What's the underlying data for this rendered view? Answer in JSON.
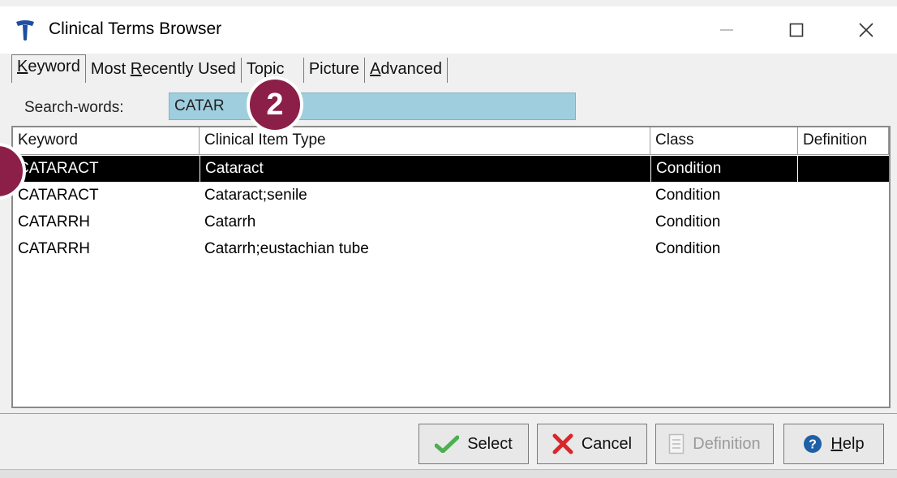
{
  "window": {
    "title": "Clinical Terms Browser",
    "icon": "telstra-health-icon"
  },
  "title_buttons": {
    "minimize": "minimize-icon",
    "maximize": "maximize-icon",
    "close": "close-icon"
  },
  "tabs": [
    {
      "pre": "",
      "accel": "K",
      "post": "eyword",
      "active": true
    },
    {
      "pre": "Most ",
      "accel": "R",
      "post": "ecently Used",
      "active": false
    },
    {
      "pre": "",
      "accel": "",
      "post": "Topic",
      "active": false
    },
    {
      "pre": "Picture",
      "accel": "",
      "post": "",
      "active": false
    },
    {
      "pre": "",
      "accel": "A",
      "post": "dvanced",
      "active": false
    }
  ],
  "search": {
    "label": "Search-words:",
    "value": "CATAR"
  },
  "columns": [
    "Keyword",
    "Clinical Item Type",
    "Class",
    "Definition"
  ],
  "rows": [
    {
      "keyword": "CATARACT",
      "type": "Cataract",
      "class": "Condition",
      "definition": ""
    },
    {
      "keyword": "CATARACT",
      "type": "Cataract;senile",
      "class": "Condition",
      "definition": ""
    },
    {
      "keyword": "CATARRH",
      "type": "Catarrh",
      "class": "Condition",
      "definition": ""
    },
    {
      "keyword": "CATARRH",
      "type": "Catarrh;eustachian tube",
      "class": "Condition",
      "definition": ""
    }
  ],
  "selected_row": 0,
  "buttons": {
    "select": {
      "label": "Select",
      "icon": "checkmark-icon"
    },
    "cancel": {
      "label": "Cancel",
      "icon": "x-cancel-icon"
    },
    "definition": {
      "label": "Definition",
      "icon": "document-icon",
      "enabled": false
    },
    "help": {
      "pre": "",
      "accel": "H",
      "post": "elp",
      "icon": "help-icon"
    }
  },
  "callouts": {
    "badge_2": "2"
  },
  "colors": {
    "search_bg": "#9fcfde",
    "selected_row_bg": "#000000",
    "callout": "#8b1f47",
    "check_green": "#4caf50",
    "cancel_red": "#d9262b",
    "help_blue": "#1f5fa8"
  }
}
